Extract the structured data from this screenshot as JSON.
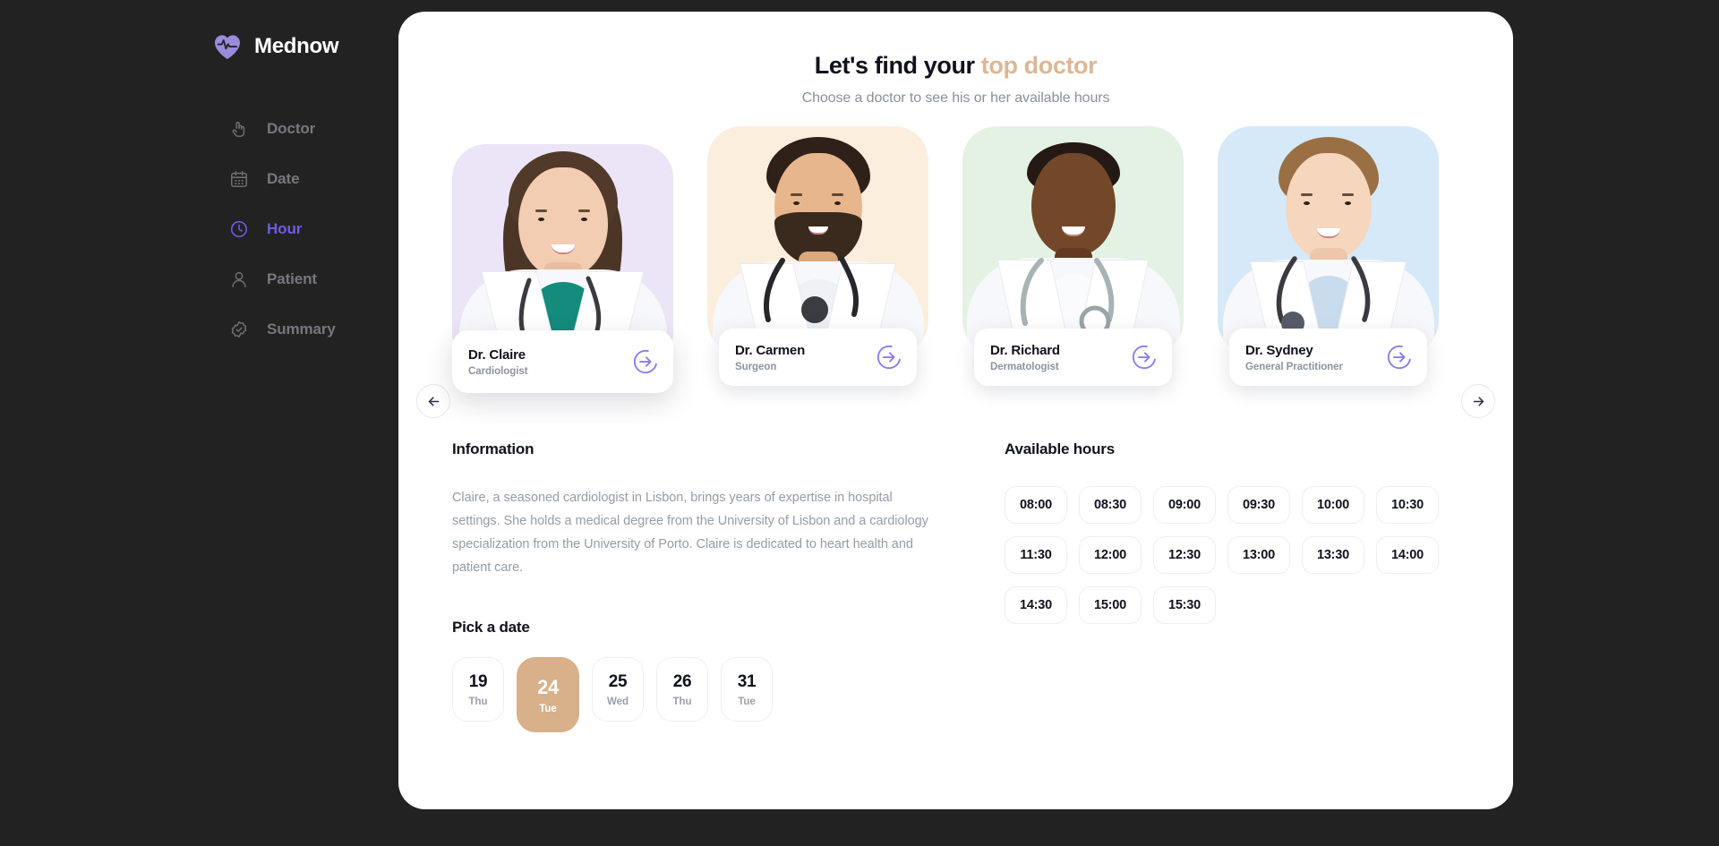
{
  "brand": {
    "name": "Mednow",
    "logo_icon": "heart-pulse-icon",
    "logo_color": "#9b8cdb"
  },
  "sidebar": {
    "items": [
      {
        "label": "Doctor",
        "icon": "hand-pointer-icon",
        "active": false
      },
      {
        "label": "Date",
        "icon": "calendar-icon",
        "active": false
      },
      {
        "label": "Hour",
        "icon": "clock-icon",
        "active": true
      },
      {
        "label": "Patient",
        "icon": "user-icon",
        "active": false
      },
      {
        "label": "Summary",
        "icon": "badge-check-icon",
        "active": false
      }
    ],
    "active_color": "#6c5ce7",
    "inactive_color": "#77777e"
  },
  "header": {
    "title_plain": "Let's find your ",
    "title_accent": "top doctor",
    "accent_color": "#dcb795",
    "subtitle": "Choose a doctor to see his or her available hours"
  },
  "carousel": {
    "prev_icon": "arrow-left-icon",
    "next_icon": "arrow-right-icon",
    "doctors": [
      {
        "name": "Dr. Claire",
        "specialty": "Cardiologist",
        "bg": "#ece4f7",
        "go_icon": "arrow-right-circle-icon",
        "selected": true
      },
      {
        "name": "Dr. Carmen",
        "specialty": "Surgeon",
        "bg": "#fbeedd",
        "go_icon": "arrow-right-circle-icon",
        "selected": false
      },
      {
        "name": "Dr. Richard",
        "specialty": "Dermatologist",
        "bg": "#e4f2e4",
        "go_icon": "arrow-right-circle-icon",
        "selected": false
      },
      {
        "name": "Dr. Sydney",
        "specialty": "General Practitioner",
        "bg": "#d6e9f8",
        "go_icon": "arrow-right-circle-icon",
        "selected": false
      }
    ]
  },
  "information": {
    "title": "Information",
    "bio": "Claire, a seasoned cardiologist in Lisbon, brings years of expertise in hospital settings. She holds a medical degree from the University of Lisbon and a cardiology specialization from the University of Porto. Claire is dedicated to heart health and patient care."
  },
  "pick_date": {
    "title": "Pick a date",
    "selected_color": "#d8b089",
    "dates": [
      {
        "day": "19",
        "dow": "Thu",
        "selected": false
      },
      {
        "day": "24",
        "dow": "Tue",
        "selected": true
      },
      {
        "day": "25",
        "dow": "Wed",
        "selected": false
      },
      {
        "day": "26",
        "dow": "Thu",
        "selected": false
      },
      {
        "day": "31",
        "dow": "Tue",
        "selected": false
      }
    ]
  },
  "available_hours": {
    "title": "Available hours",
    "hours": [
      "08:00",
      "08:30",
      "09:00",
      "09:30",
      "10:00",
      "10:30",
      "11:30",
      "12:00",
      "12:30",
      "13:00",
      "13:30",
      "14:00",
      "14:30",
      "15:00",
      "15:30"
    ]
  }
}
